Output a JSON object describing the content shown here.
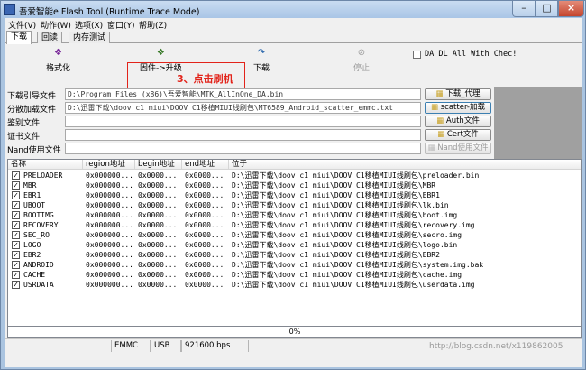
{
  "window": {
    "title": "吾爱智能e Flash Tool (Runtime Trace Mode)"
  },
  "menu": [
    "文件(V)",
    "动作(W)",
    "选项(X)",
    "窗口(Y)",
    "帮助(Z)"
  ],
  "tabs": [
    "下载",
    "回读",
    "内存测试"
  ],
  "toolbar": {
    "format_label": "格式化",
    "upgrade_label": "固件->升级",
    "download_label": "下载",
    "stop_label": "停止",
    "dadl_label": "DA DL All With Chec!",
    "callout": "3、点击刷机"
  },
  "files": [
    {
      "label": "下载引导文件",
      "value": "D:\\Program Files (x86)\\吾爱智能\\MTK_AllInOne_DA.bin",
      "button": "下载_代理",
      "button_state": "normal"
    },
    {
      "label": "分散加载文件",
      "value": "D:\\迅雷下载\\doov c1 miui\\DOOV C1移植MIUI线刷包\\MT6589_Android_scatter_emmc.txt",
      "button": "scatter-加载",
      "button_state": "focus"
    },
    {
      "label": "鉴别文件",
      "value": "",
      "button": "Auth文件",
      "button_state": "normal"
    },
    {
      "label": "证书文件",
      "value": "",
      "button": "Cert文件",
      "button_state": "normal"
    },
    {
      "label": "Nand使用文件",
      "value": "",
      "button": "Nand使用文件",
      "button_state": "disabled"
    }
  ],
  "table": {
    "columns": [
      "名称",
      "region地址",
      "begin地址",
      "end地址",
      "位于"
    ],
    "rows": [
      {
        "name": "PRELOADER",
        "region": "0x000000...",
        "begin": "0x0000...",
        "end": "0x0000...",
        "location": "D:\\迅雷下载\\doov c1 miui\\DOOV C1移植MIUI线刷包\\preloader.bin"
      },
      {
        "name": "MBR",
        "region": "0x000000...",
        "begin": "0x0000...",
        "end": "0x0000...",
        "location": "D:\\迅雷下载\\doov c1 miui\\DOOV C1移植MIUI线刷包\\MBR"
      },
      {
        "name": "EBR1",
        "region": "0x000000...",
        "begin": "0x0000...",
        "end": "0x0000...",
        "location": "D:\\迅雷下载\\doov c1 miui\\DOOV C1移植MIUI线刷包\\EBR1"
      },
      {
        "name": "UBOOT",
        "region": "0x000000...",
        "begin": "0x0000...",
        "end": "0x0000...",
        "location": "D:\\迅雷下载\\doov c1 miui\\DOOV C1移植MIUI线刷包\\lk.bin"
      },
      {
        "name": "BOOTIMG",
        "region": "0x000000...",
        "begin": "0x0000...",
        "end": "0x0000...",
        "location": "D:\\迅雷下载\\doov c1 miui\\DOOV C1移植MIUI线刷包\\boot.img"
      },
      {
        "name": "RECOVERY",
        "region": "0x000000...",
        "begin": "0x0000...",
        "end": "0x0000...",
        "location": "D:\\迅雷下载\\doov c1 miui\\DOOV C1移植MIUI线刷包\\recovery.img"
      },
      {
        "name": "SEC_RO",
        "region": "0x000000...",
        "begin": "0x0000...",
        "end": "0x0000...",
        "location": "D:\\迅雷下载\\doov c1 miui\\DOOV C1移植MIUI线刷包\\secro.img"
      },
      {
        "name": "LOGO",
        "region": "0x000000...",
        "begin": "0x0000...",
        "end": "0x0000...",
        "location": "D:\\迅雷下载\\doov c1 miui\\DOOV C1移植MIUI线刷包\\logo.bin"
      },
      {
        "name": "EBR2",
        "region": "0x000000...",
        "begin": "0x0000...",
        "end": "0x0000...",
        "location": "D:\\迅雷下载\\doov c1 miui\\DOOV C1移植MIUI线刷包\\EBR2"
      },
      {
        "name": "ANDROID",
        "region": "0x000000...",
        "begin": "0x0000...",
        "end": "0x0000...",
        "location": "D:\\迅雷下载\\doov c1 miui\\DOOV C1移植MIUI线刷包\\system.img.bak"
      },
      {
        "name": "CACHE",
        "region": "0x000000...",
        "begin": "0x0000...",
        "end": "0x0000...",
        "location": "D:\\迅雷下载\\doov c1 miui\\DOOV C1移植MIUI线刷包\\cache.img"
      },
      {
        "name": "USRDATA",
        "region": "0x000000...",
        "begin": "0x0000...",
        "end": "0x0000...",
        "location": "D:\\迅雷下载\\doov c1 miui\\DOOV C1移植MIUI线刷包\\userdata.img"
      }
    ]
  },
  "progress": {
    "text": "0%",
    "value": 0
  },
  "status": {
    "storage": "EMMC",
    "port": "USB",
    "baud": "921600 bps"
  },
  "watermark": "http://blog.csdn.net/x119862005",
  "icons": {
    "format": "format-icon",
    "upgrade": "upgrade-icon",
    "download": "download-arrow-icon",
    "stop": "stop-icon",
    "folder": "folder-icon"
  },
  "colors": {
    "accent": "#e2231a",
    "title_bar": "#aac4e0"
  }
}
